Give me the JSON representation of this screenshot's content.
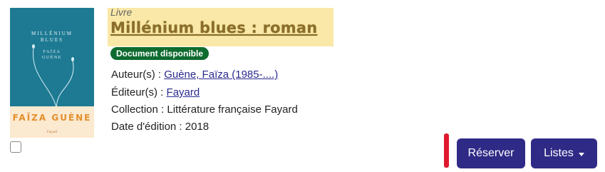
{
  "cover": {
    "title": "MILLÉNIUM\nBLUES",
    "author_small": "FAÏZA\nGUÈNE",
    "author": "FAÏZA GUÈNE",
    "publisher": "Fayard"
  },
  "record": {
    "doc_type": "Livre",
    "title": "Millénium blues : roman",
    "status": "Document disponible",
    "author_label": "Auteur(s) : ",
    "author_value": "Guène, Faïza (1985-....)",
    "publisher_label": "Éditeur(s) : ",
    "publisher_value": "Fayard",
    "collection_label": "Collection : ",
    "collection_value": "Littérature française Fayard",
    "date_label": "Date d'édition : ",
    "date_value": "2018"
  },
  "actions": {
    "reserve_label": "Réserver",
    "lists_label": "Listes"
  },
  "colors": {
    "accent": "#2f2a86",
    "status_green": "#0f6b2f",
    "highlight": "#f9e8a7",
    "marker_red": "#e0192e"
  }
}
